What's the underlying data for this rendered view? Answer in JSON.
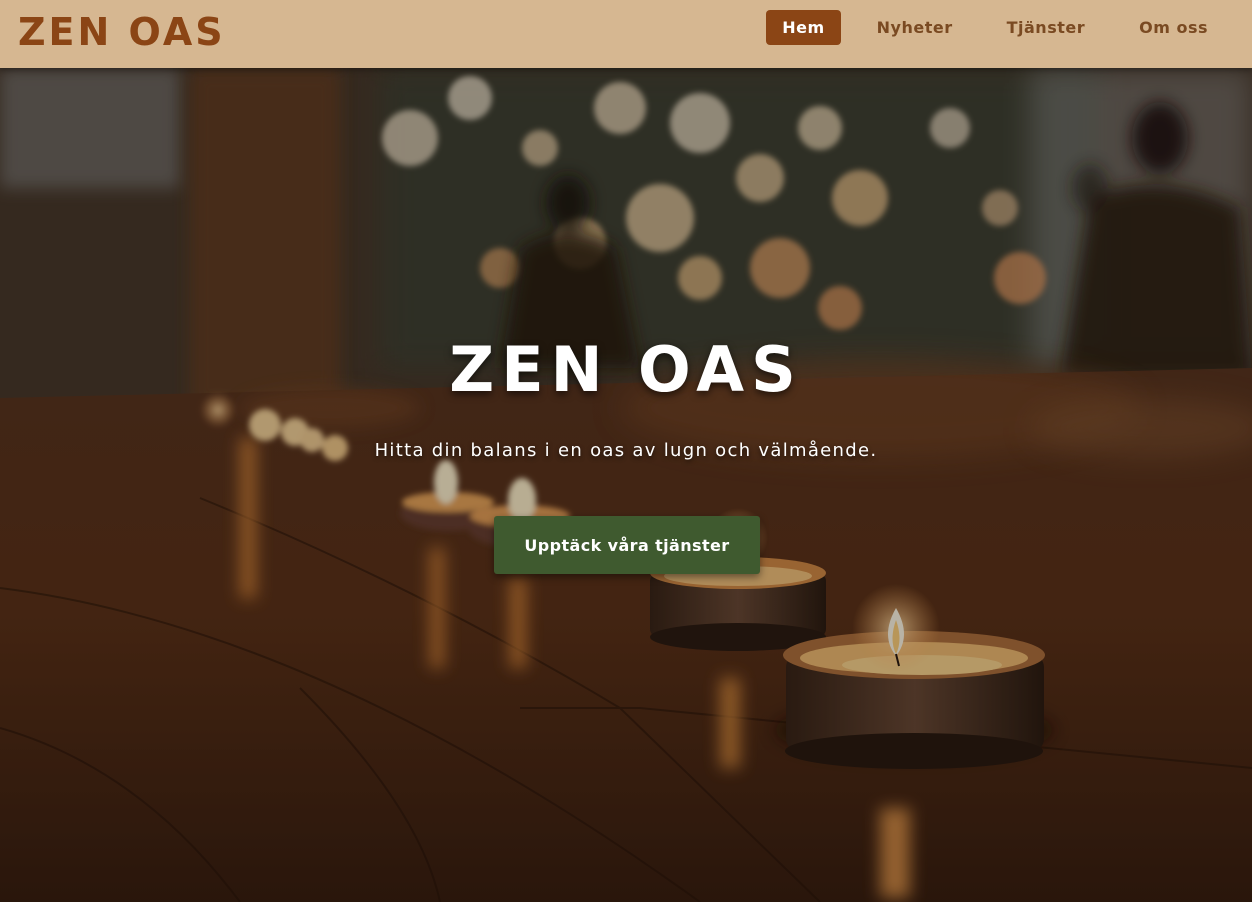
{
  "header": {
    "logo": "ZEN OAS",
    "nav": [
      {
        "label": "Hem",
        "active": true
      },
      {
        "label": "Nyheter",
        "active": false
      },
      {
        "label": "Tjänster",
        "active": false
      },
      {
        "label": "Om oss",
        "active": false
      }
    ]
  },
  "hero": {
    "title": "ZEN OAS",
    "subtitle": "Hitta din balans i en oas av lugn och välmående.",
    "cta_label": "Upptäck våra tjänster",
    "background_image": "candle-lit-yoga-studio-floor"
  },
  "colors": {
    "header_bg": "#d6b791",
    "brand": "#8b4515",
    "nav_text": "#7a4a22",
    "cta_bg": "#3f5a2f",
    "hero_text": "#ffffff"
  }
}
